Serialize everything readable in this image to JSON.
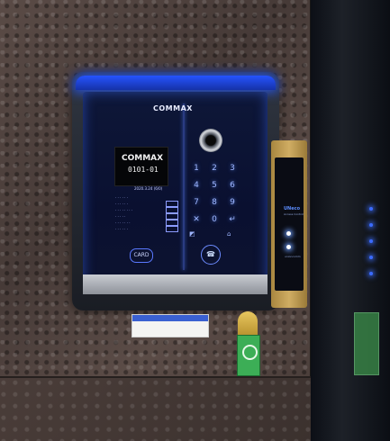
{
  "brand": "COMMAX",
  "lcd": {
    "line1": "COMMAX",
    "line2": "0101-01"
  },
  "lcd_date": "2020.3.24 (6/0)",
  "card_label": "CARD",
  "keypad": [
    "1",
    "2",
    "3",
    "4",
    "5",
    "6",
    "7",
    "8",
    "9",
    "✕",
    "0",
    "↵"
  ],
  "reader": {
    "brand": "UNeco",
    "subtitle": "Access Control",
    "maker": "unioncomm"
  },
  "colors": {
    "panel_glow": "#2553ff",
    "reader_gold": "#d0ad63",
    "keypad_text": "#9fb6ff"
  }
}
